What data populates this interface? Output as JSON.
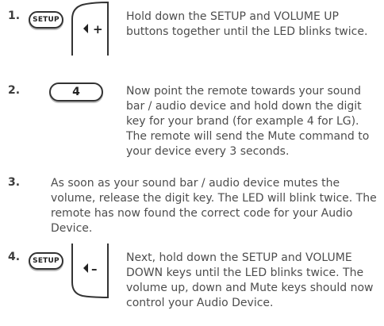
{
  "steps": [
    {
      "number": "1.",
      "setup_label": "SETUP",
      "volume_label": "+",
      "text": "Hold down the SETUP and VOLUME UP buttons together until the LED blinks twice."
    },
    {
      "number": "2.",
      "digit_label": "4",
      "text": "Now point the remote towards your sound bar / audio device and hold down the digit key for your brand (for example 4 for LG). The remote will send the Mute command to your device every 3 seconds."
    },
    {
      "number": "3.",
      "text": "As soon as your sound bar / audio device mutes the volume, release the digit key. The LED will blink twice. The remote has now found the correct code for your Audio Device."
    },
    {
      "number": "4.",
      "setup_label": "SETUP",
      "volume_label": "–",
      "text": "Next, hold down the SETUP and VOLUME DOWN keys until the LED blinks twice. The volume up, down and Mute keys should now control your Audio Device."
    }
  ]
}
